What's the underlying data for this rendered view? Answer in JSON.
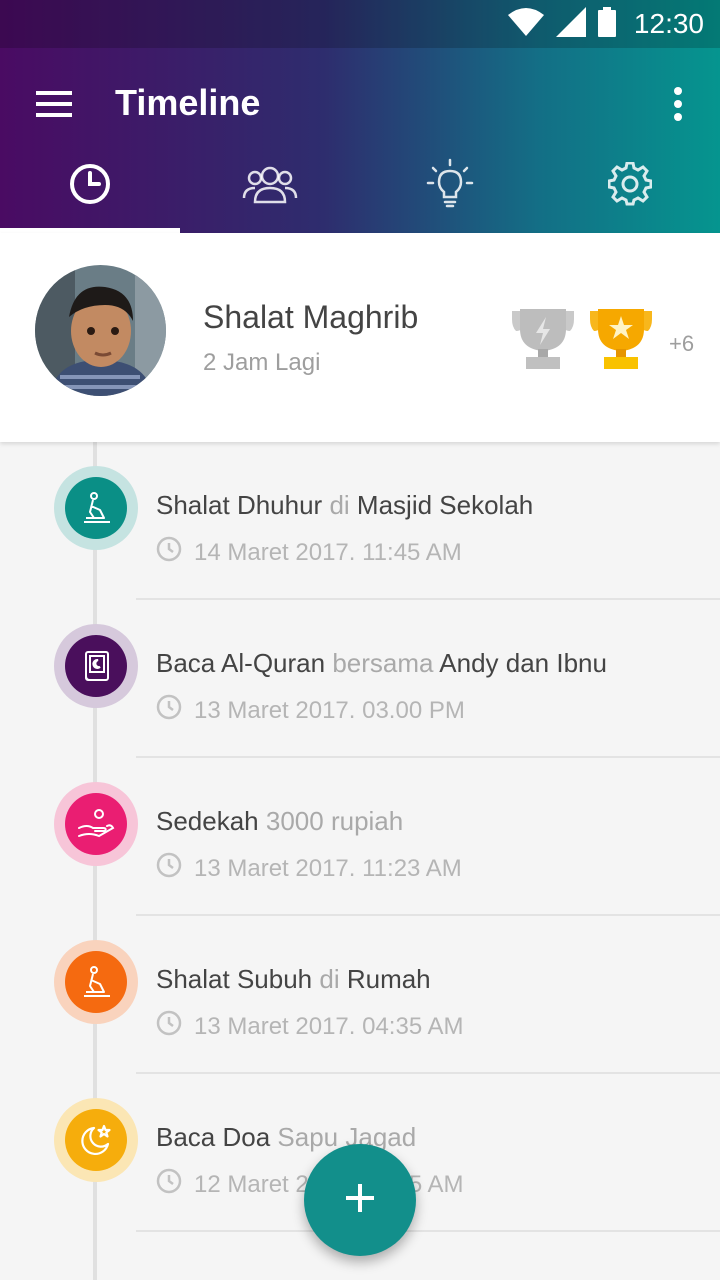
{
  "status_bar": {
    "time": "12:30",
    "icons": [
      "wifi-icon",
      "signal-icon",
      "battery-icon"
    ]
  },
  "toolbar": {
    "title": "Timeline",
    "menu_icon": "hamburger-menu-icon",
    "more_icon": "more-vert-icon"
  },
  "tabs": [
    {
      "icon": "clock-icon",
      "active": true
    },
    {
      "icon": "group-icon",
      "active": false
    },
    {
      "icon": "lightbulb-icon",
      "active": false
    },
    {
      "icon": "gear-icon",
      "active": false
    }
  ],
  "current": {
    "title": "Shalat Maghrib",
    "subtitle": "2 Jam Lagi",
    "trophy_more": "+6"
  },
  "items": [
    {
      "activity": "Shalat Dhuhur",
      "connector": " di ",
      "detail": "Masjid Sekolah",
      "detail_muted": false,
      "time": "14 Maret 2017. 11:45 AM",
      "color": "#0a8f86",
      "ring": "#c5e3e1",
      "icon": "prayer-icon"
    },
    {
      "activity": "Baca Al-Quran",
      "connector": " bersama ",
      "detail": "Andy dan Ibnu",
      "detail_muted": false,
      "time": "13 Maret 2017. 03.00 PM",
      "color": "#4a0f5c",
      "ring": "#d6c9dc",
      "icon": "quran-book-icon"
    },
    {
      "activity": "Sedekah",
      "connector": " ",
      "detail": "3000 rupiah",
      "detail_muted": true,
      "time": "13 Maret 2017. 11:23 AM",
      "color": "#ea1e72",
      "ring": "#f7c5d8",
      "icon": "charity-hand-icon"
    },
    {
      "activity": "Shalat Subuh",
      "connector": " di ",
      "detail": "Rumah",
      "detail_muted": false,
      "time": "13 Maret 2017. 04:35 AM",
      "color": "#f56a10",
      "ring": "#f9d3bd",
      "icon": "prayer-icon"
    },
    {
      "activity": "Baca Doa",
      "connector": " ",
      "detail": "Sapu Jagad",
      "detail_muted": true,
      "time": "12 Maret 2017. 05:55 AM",
      "color": "#f6ad0c",
      "ring": "#fbe6b4",
      "icon": "moon-star-icon"
    }
  ],
  "fab": {
    "icon": "plus-icon"
  }
}
